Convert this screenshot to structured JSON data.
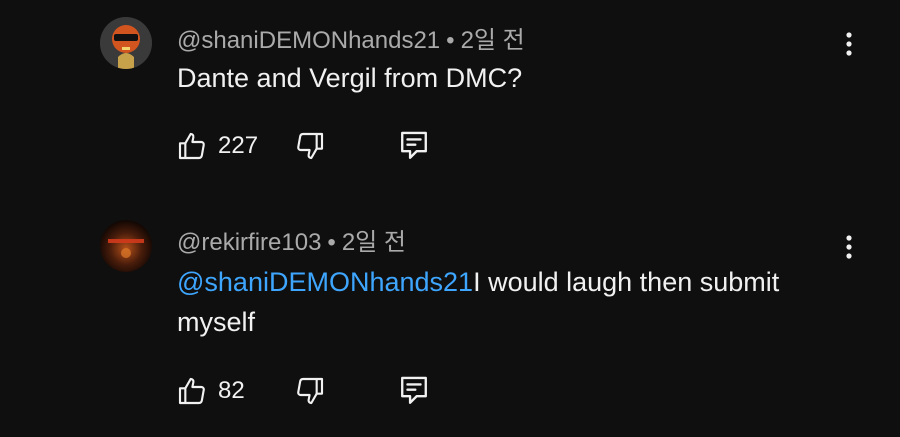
{
  "comments": [
    {
      "author": "@shaniDEMONhands21",
      "separator": "•",
      "time": "2일 전",
      "text": "Dante and Vergil from DMC?",
      "mention": "",
      "likes": "227",
      "icons": {
        "like": "thumbs-up-icon",
        "dislike": "thumbs-down-icon",
        "reply": "comment-reply-icon",
        "menu": "more-vert-icon"
      }
    },
    {
      "author": "@rekirfire103",
      "separator": "•",
      "time": "2일 전",
      "mention": "@shaniDEMONhands21",
      "text": "I would laugh then submit myself",
      "likes": "82",
      "icons": {
        "like": "thumbs-up-icon",
        "dislike": "thumbs-down-icon",
        "reply": "comment-reply-icon",
        "menu": "more-vert-icon"
      }
    }
  ],
  "colors": {
    "background": "#0f0f0f",
    "text": "#f1f1f1",
    "meta": "#aaaaaa",
    "mention": "#3ea6ff"
  }
}
